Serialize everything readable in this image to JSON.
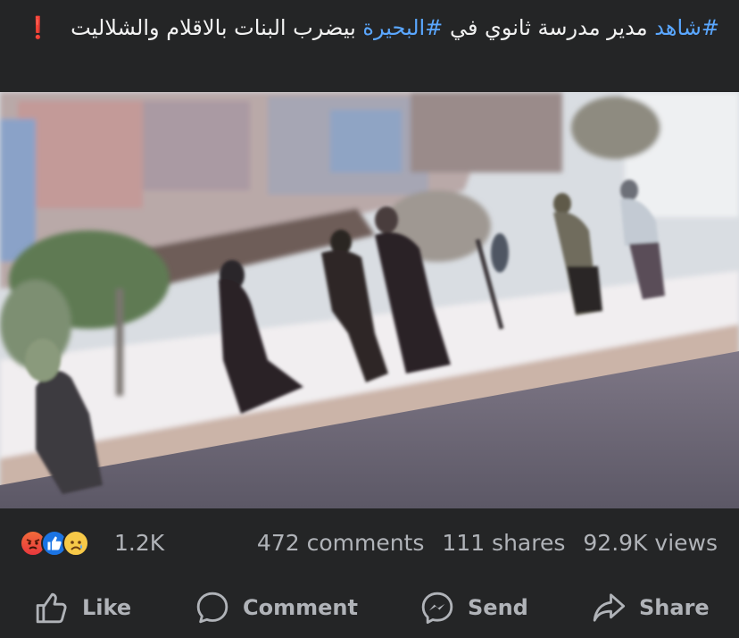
{
  "post": {
    "caption_tag1": "#شاهد",
    "caption_text1": "مدير مدرسة ثانوي في",
    "caption_tag2": "#البحيرة",
    "caption_text2": "بيضرب البنات بالاقلام والشلاليت",
    "caption_emoji": "❗"
  },
  "media": {
    "description_icon": "video-frame"
  },
  "stats": {
    "reactions": [
      "angry-reaction-icon",
      "like-reaction-icon",
      "sad-reaction-icon"
    ],
    "reaction_count": "1.2K",
    "comments": "472 comments",
    "shares": "111 shares",
    "views": "92.9K views"
  },
  "actions": {
    "like": "Like",
    "comment": "Comment",
    "send": "Send",
    "share": "Share"
  },
  "colors": {
    "background": "#242526",
    "hashtag": "#5aa7ff",
    "muted_text": "#b0b3b8",
    "like_blue": "#1b74e4"
  }
}
